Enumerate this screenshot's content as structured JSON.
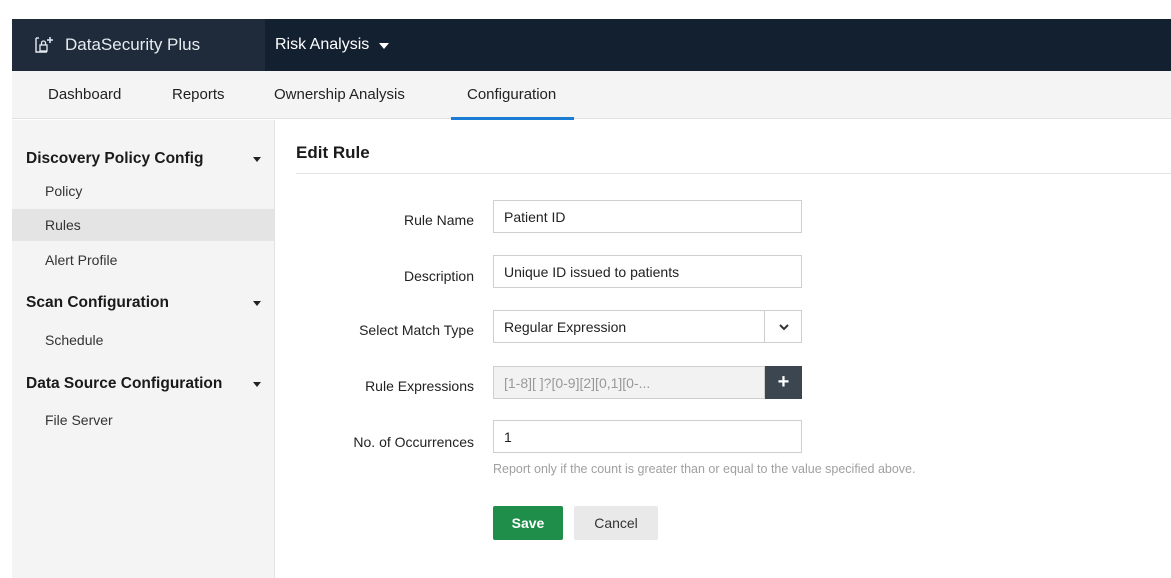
{
  "header": {
    "brand_name": "DataSecurity Plus",
    "brand_icon": "lock-icon",
    "module_name": "Risk Analysis"
  },
  "tabs": [
    {
      "label": "Dashboard"
    },
    {
      "label": "Reports"
    },
    {
      "label": "Ownership Analysis"
    },
    {
      "label": "Configuration",
      "active": true
    }
  ],
  "sidebar": {
    "sections": [
      {
        "title": "Discovery Policy Config",
        "items": [
          "Policy",
          "Rules",
          "Alert Profile"
        ]
      },
      {
        "title": "Scan Configuration",
        "items": [
          "Schedule"
        ]
      },
      {
        "title": "Data Source Configuration",
        "items": [
          "File Server"
        ]
      }
    ],
    "active_item": "Rules"
  },
  "page": {
    "title": "Edit Rule"
  },
  "form": {
    "rule_name_label": "Rule Name",
    "rule_name_value": "Patient ID",
    "description_label": "Description",
    "description_value": "Unique ID issued to patients",
    "match_type_label": "Select Match Type",
    "match_type_value": "Regular Expression",
    "expressions_label": "Rule Expressions",
    "expressions_value": "[1-8][ ]?[0-9][2][0,1][0-...",
    "add_expression_label": "+",
    "occurrences_label": "No. of Occurrences",
    "occurrences_value": "1",
    "occurrences_hint": "Report only if the count is greater than or equal to the value specified above.",
    "save_label": "Save",
    "cancel_label": "Cancel"
  },
  "colors": {
    "topbar": "#13202f",
    "brand_bg": "#1f2b3a",
    "tab_active": "#1b7cd3",
    "save_button": "#1e8e4a",
    "add_button": "#3b4650"
  }
}
